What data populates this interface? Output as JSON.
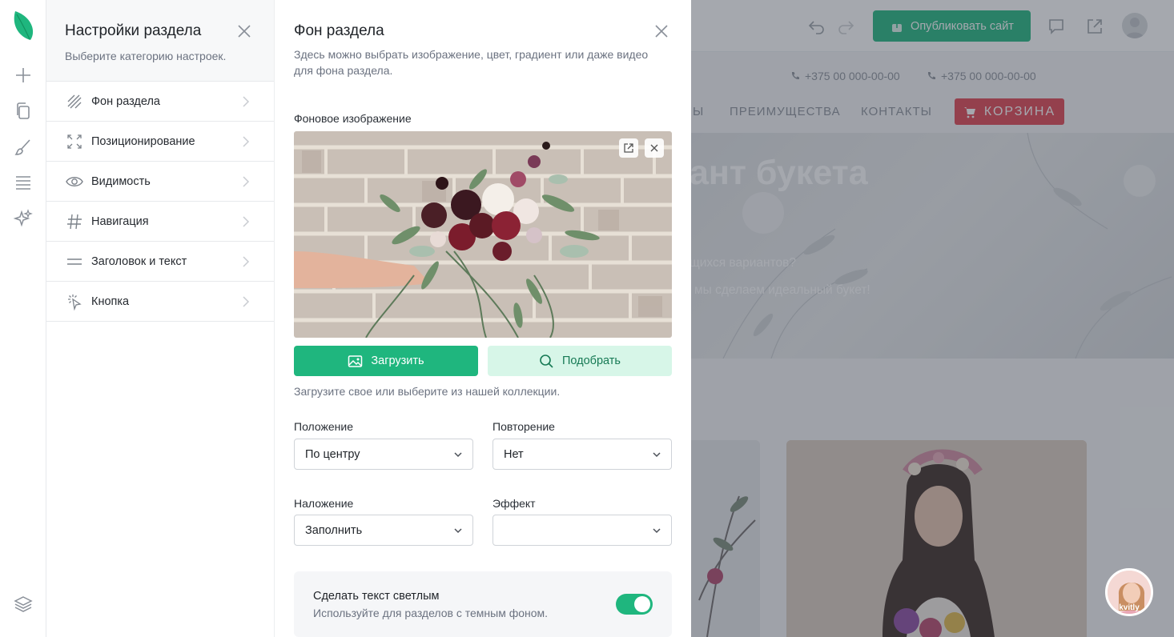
{
  "rail": {
    "items": [
      {
        "name": "add",
        "icon": "plus-icon"
      },
      {
        "name": "pages",
        "icon": "pages-icon"
      },
      {
        "name": "design",
        "icon": "brush-icon"
      },
      {
        "name": "sections",
        "icon": "sections-icon"
      },
      {
        "name": "ai",
        "icon": "sparkles-icon"
      },
      {
        "name": "layers",
        "icon": "layers-icon"
      }
    ],
    "logo_color": "#1fb67e"
  },
  "category_panel": {
    "title": "Настройки раздела",
    "subtitle": "Выберите категорию настроек.",
    "items": [
      {
        "label": "Фон раздела",
        "icon": "hatch-icon"
      },
      {
        "label": "Позиционирование",
        "icon": "expand-icon"
      },
      {
        "label": "Видимость",
        "icon": "eye-icon"
      },
      {
        "label": "Навигация",
        "icon": "hash-icon"
      },
      {
        "label": "Заголовок и текст",
        "icon": "text-lines-icon"
      },
      {
        "label": "Кнопка",
        "icon": "click-icon"
      }
    ]
  },
  "background_panel": {
    "title": "Фон раздела",
    "description": "Здесь можно выбрать изображение, цвет, градиент или даже видео для фона раздела.",
    "image_label": "Фоновое изображение",
    "upload_label": "Загрузить",
    "pick_label": "Подобрать",
    "hint": "Загрузите свое или выберите из нашей коллекции.",
    "position": {
      "label": "Положение",
      "value": "По центру"
    },
    "repeat": {
      "label": "Повторение",
      "value": "Нет"
    },
    "overlay": {
      "label": "Наложение",
      "value": "Заполнить"
    },
    "effect": {
      "label": "Эффект",
      "value": ""
    },
    "light_text": {
      "title": "Сделать текст светлым",
      "subtitle": "Используйте для разделов с темным фоном.",
      "enabled": true
    },
    "accent": "#1fb67e"
  },
  "site_preview": {
    "publish_label": "Опубликовать сайт",
    "phone_1": "+375 00 000-00-00",
    "phone_2": "+375 00 000-00-00",
    "nav_partial": "Ы",
    "nav_advantages": "ПРЕИМУЩЕСТВА",
    "nav_contacts": "КОНТАКТЫ",
    "cart_label": "КОРЗИНА",
    "hero_title_partial": "ант букета",
    "hero_line_1_partial": "щихся вариантов?",
    "hero_line_2_partial": "мы сделаем идеальный букет!",
    "chat_label": "kvitly",
    "cart_color": "#e0434f"
  }
}
